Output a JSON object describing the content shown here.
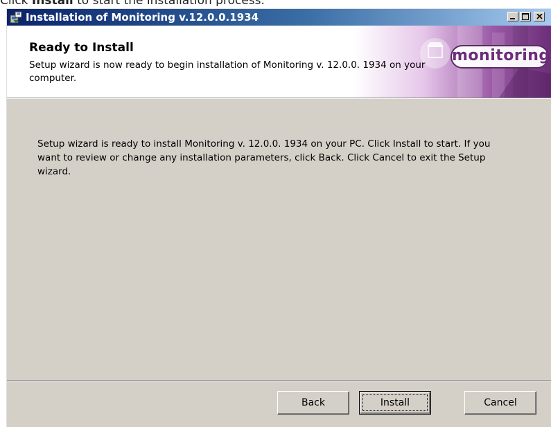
{
  "caption": {
    "prefix": "Click ",
    "bold": "Install",
    "suffix": " to start the installation process."
  },
  "window": {
    "title": "Installation of Monitoring v.12.0.0.1934",
    "title_icon": "installer-icon"
  },
  "banner": {
    "title": "Ready to Install",
    "description": "Setup wizard is now ready to begin installation of Monitoring v. 12.0.0. 1934 on your computer.",
    "logo_text": "monitoring",
    "logo_color": "#6b2d78"
  },
  "body": {
    "text": "Setup wizard is ready to install Monitoring v. 12.0.0. 1934 on your PC. Click Install to start. If you want to review or change any installation parameters, click Back. Click Cancel to exit the Setup wizard."
  },
  "buttons": {
    "back": "Back",
    "install": "Install",
    "cancel": "Cancel"
  },
  "colors": {
    "titlebar_start": "#0a246a",
    "titlebar_end": "#a6caf0",
    "dialog_face": "#d4d0c8"
  }
}
